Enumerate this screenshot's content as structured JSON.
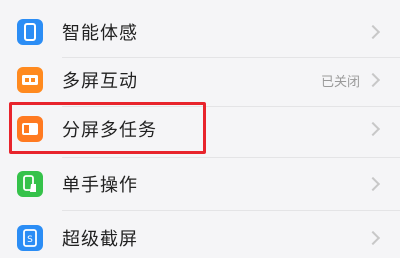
{
  "settings": {
    "items": [
      {
        "label": "智能体感",
        "value": "",
        "icon": "phone-icon",
        "color": "#2b8df5"
      },
      {
        "label": "多屏互动",
        "value": "已关闭",
        "icon": "screen-cast-icon",
        "color": "#ff8a1f"
      },
      {
        "label": "分屏多任务",
        "value": "",
        "icon": "split-screen-icon",
        "color": "#ff7a21"
      },
      {
        "label": "单手操作",
        "value": "",
        "icon": "hand-icon",
        "color": "#35c24a"
      },
      {
        "label": "超级截屏",
        "value": "",
        "icon": "screenshot-icon",
        "color": "#2b8df5"
      }
    ],
    "highlight_color": "#e8242c"
  }
}
